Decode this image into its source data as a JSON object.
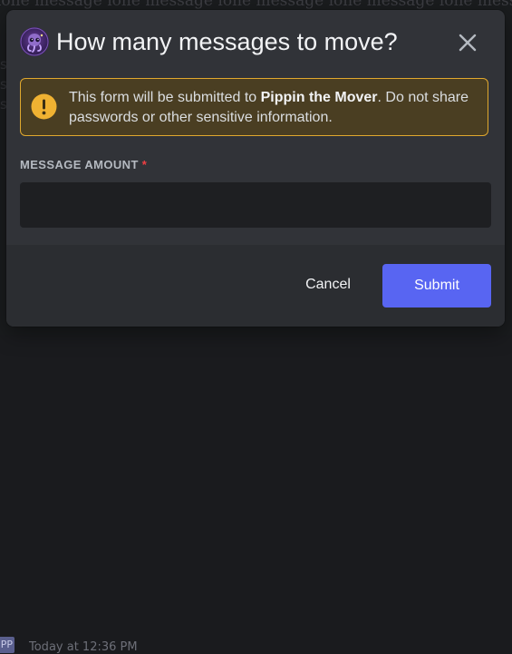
{
  "background": {
    "chat_text": "ione message ione message ione message ione message ione message ione message",
    "side_text": "s",
    "avatar_initials": "PP",
    "timestamp": "Today at 12:36 PM"
  },
  "modal": {
    "app_icon": "bot-avatar-icon",
    "title": "How many messages to move?",
    "close_icon": "close-icon",
    "warning": {
      "icon": "warning-icon",
      "text_before": "This form will be submitted to ",
      "bot_name": "Pippin the Mover",
      "text_after": ". Do not share passwords or other sensitive information."
    },
    "field": {
      "label": "MESSAGE AMOUNT",
      "required_marker": "*",
      "value": "",
      "placeholder": ""
    },
    "footer": {
      "cancel_label": "Cancel",
      "submit_label": "Submit"
    }
  },
  "colors": {
    "accent": "#5865f2",
    "warning_border": "#e0a82e",
    "warning_bg": "#4a3e22",
    "required": "#f23f43",
    "modal_bg": "#313338",
    "footer_bg": "#2b2d31",
    "input_bg": "#1e1f22"
  }
}
